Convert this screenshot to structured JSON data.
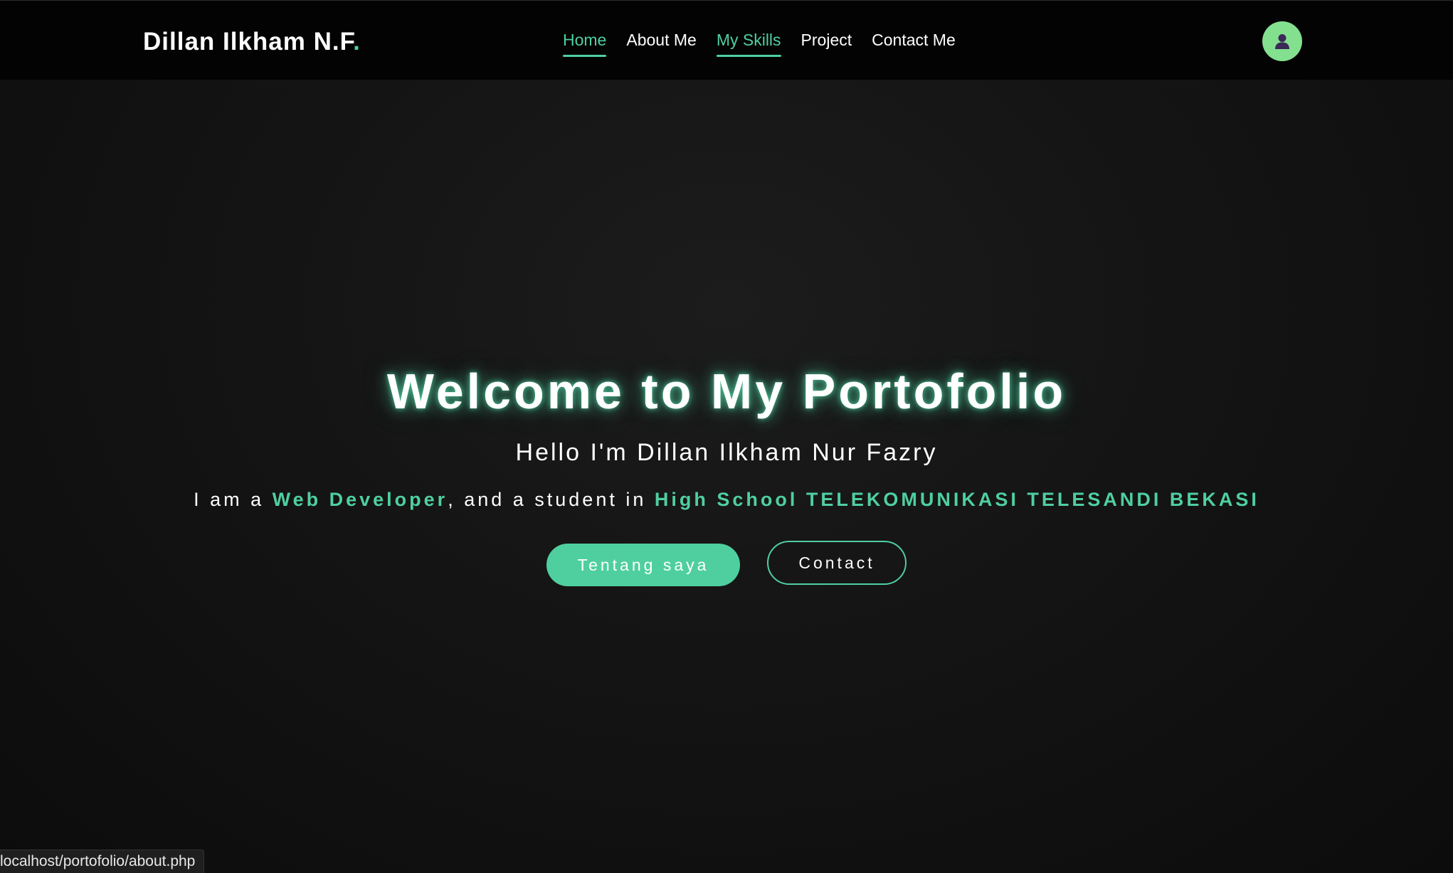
{
  "brand": {
    "name": "Dillan Ilkham N.F",
    "dot": "."
  },
  "nav": {
    "items": [
      {
        "label": "Home",
        "active": true
      },
      {
        "label": "About Me",
        "active": false
      },
      {
        "label": "My Skills",
        "active": true
      },
      {
        "label": "Project",
        "active": false
      },
      {
        "label": "Contact Me",
        "active": false
      }
    ]
  },
  "user": {
    "icon": "user-icon"
  },
  "hero": {
    "title": "Welcome to My Portofolio",
    "subtitle": "Hello I'm Dillan Ilkham Nur Fazry",
    "line": {
      "part1": "I am a ",
      "highlight1": "Web Developer",
      "part2": ", and a student in ",
      "highlight2": "High School TELEKOMUNIKASI TELESANDI BEKASI"
    },
    "buttons": {
      "primary": "Tentang saya",
      "secondary": "Contact"
    }
  },
  "status_bar": {
    "url": "localhost/portofolio/about.php"
  },
  "colors": {
    "accent": "#4fcfa0",
    "avatar_bg": "#83e08f",
    "navbar_bg": "#030303",
    "page_bg": "#121212"
  }
}
